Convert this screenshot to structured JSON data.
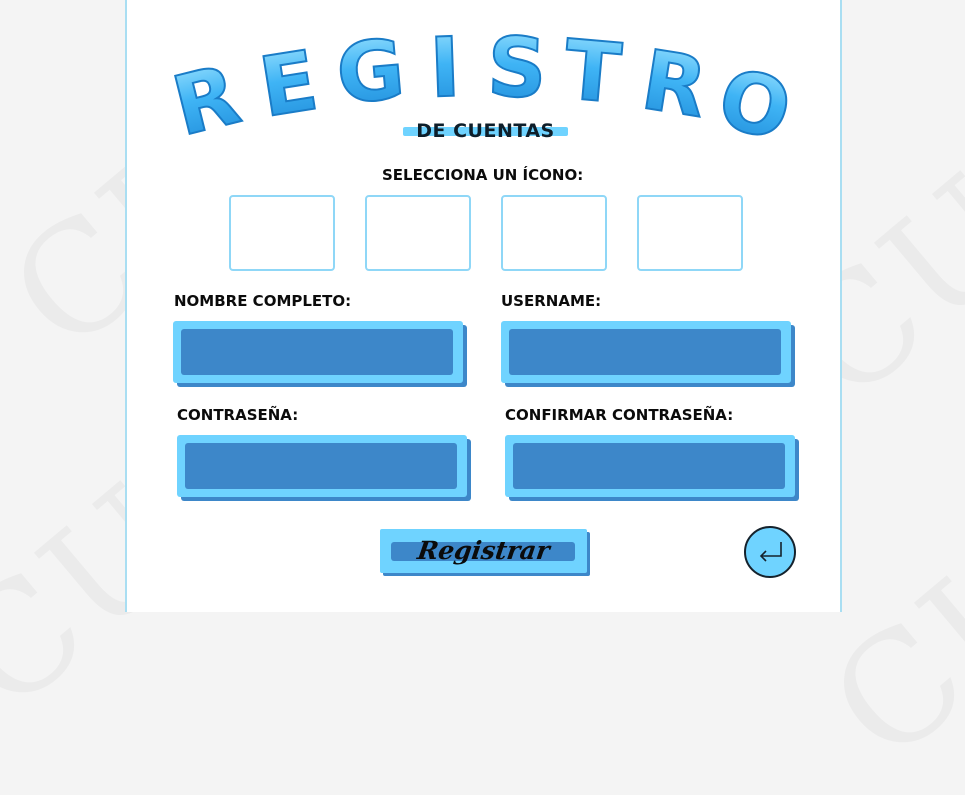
{
  "page": {
    "title": "REGISTRO",
    "subtitle": "DE CUENTAS",
    "background_watermark": "CUENTAS"
  },
  "icon_picker": {
    "label": "SELECCIONA UN ÍCONO:",
    "options": [
      "",
      "",
      "",
      ""
    ]
  },
  "form": {
    "full_name": {
      "label": "NOMBRE COMPLETO:",
      "value": ""
    },
    "username": {
      "label": "USERNAME:",
      "value": ""
    },
    "password": {
      "label": "CONTRASEÑA:",
      "value": ""
    },
    "confirm_password": {
      "label": "CONFIRMAR CONTRASEÑA:",
      "value": ""
    }
  },
  "actions": {
    "submit_label": "Registrar",
    "back_icon": "return-arrow-icon"
  },
  "colors": {
    "accent_light": "#6fd3ff",
    "accent_dark": "#3d87c9",
    "border": "#8fd7f7",
    "text": "#0b0b0b"
  }
}
